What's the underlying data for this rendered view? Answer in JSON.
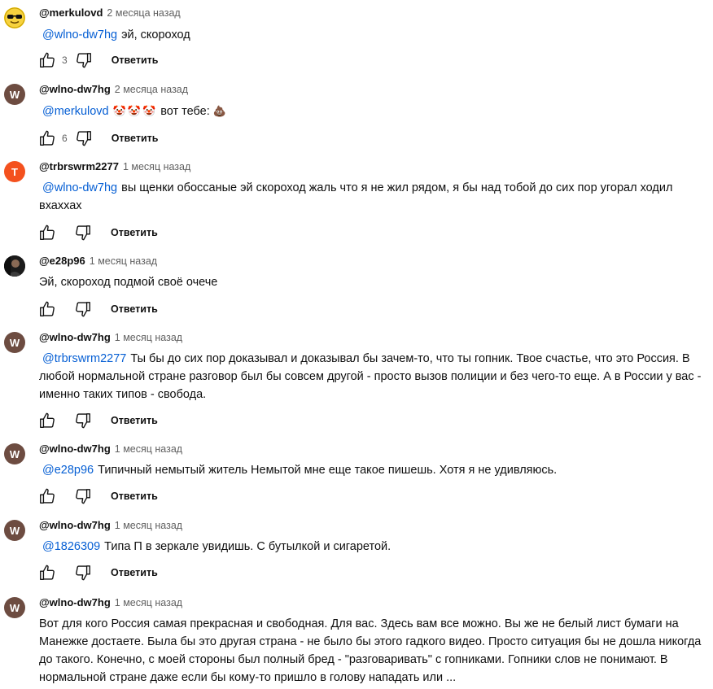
{
  "ui": {
    "reply_label": "Ответить"
  },
  "comments": [
    {
      "author": "@merkulovd",
      "time": "2 месяца назад",
      "avatar": {
        "icon": "sunglasses-face-icon",
        "bg": "#f3c614"
      },
      "mention": "@wlno-dw7hg",
      "text": "эй, скороход",
      "likes": "3"
    },
    {
      "author": "@wlno-dw7hg",
      "time": "2 месяца назад",
      "avatar": {
        "letter": "W",
        "bg": "#6d4c41"
      },
      "mention": "@merkulovd",
      "emojis": [
        "🤡",
        "🤡",
        "🤡"
      ],
      "text": "вот тебе:",
      "trail_emoji": "💩",
      "likes": "6"
    },
    {
      "author": "@trbrswrm2277",
      "time": "1 месяц назад",
      "avatar": {
        "letter": "T",
        "bg": "#f4511e"
      },
      "mention": "@wlno-dw7hg",
      "text": "вы щенки обоссаные эй скороход жаль что я не жил рядом, я бы над тобой до сих пор угорал ходил вхаххах",
      "likes": ""
    },
    {
      "author": "@e28p96",
      "time": "1 месяц назад",
      "avatar": {
        "icon": "photo-avatar-icon",
        "bg": "#2a2a2a"
      },
      "text": "Эй, скороход подмой своё очече",
      "likes": ""
    },
    {
      "author": "@wlno-dw7hg",
      "time": "1 месяц назад",
      "avatar": {
        "letter": "W",
        "bg": "#6d4c41"
      },
      "mention": "@trbrswrm2277",
      "text": "Ты бы до сих пор доказывал и доказывал бы зачем-то, что ты гопник. Твое счастье, что это Россия. В любой нормальной стране разговор был бы совсем другой - просто вызов полиции и без чего-то еще. А в России у вас - именно таких типов - свобода.",
      "likes": ""
    },
    {
      "author": "@wlno-dw7hg",
      "time": "1 месяц назад",
      "avatar": {
        "letter": "W",
        "bg": "#6d4c41"
      },
      "mention": "@e28p96",
      "text": "Типичный немытый житель Немытой мне еще такое пишешь. Хотя я не удивляюсь.",
      "likes": ""
    },
    {
      "author": "@wlno-dw7hg",
      "time": "1 месяц назад",
      "avatar": {
        "letter": "W",
        "bg": "#6d4c41"
      },
      "mention": "@1826309",
      "text": "Типа П в зеркале увидишь. С бутылкой и сигаретой.",
      "likes": ""
    },
    {
      "author": "@wlno-dw7hg",
      "time": "1 месяц назад",
      "avatar": {
        "letter": "W",
        "bg": "#6d4c41"
      },
      "text": "Вот для кого Россия самая прекрасная и свободная. Для вас. Здесь вам все можно. Вы же не белый лист бумаги на Манежке достаете. Была бы это другая страна - не было бы этого гадкого видео. Просто ситуация бы не дошла никогда до такого. Конечно, с моей стороны был полный бред - \"разговаривать\" с гопниками. Гопники слов не понимают. В нормальной стране даже если бы кому-то пришло в голову нападать или ..."
    }
  ]
}
